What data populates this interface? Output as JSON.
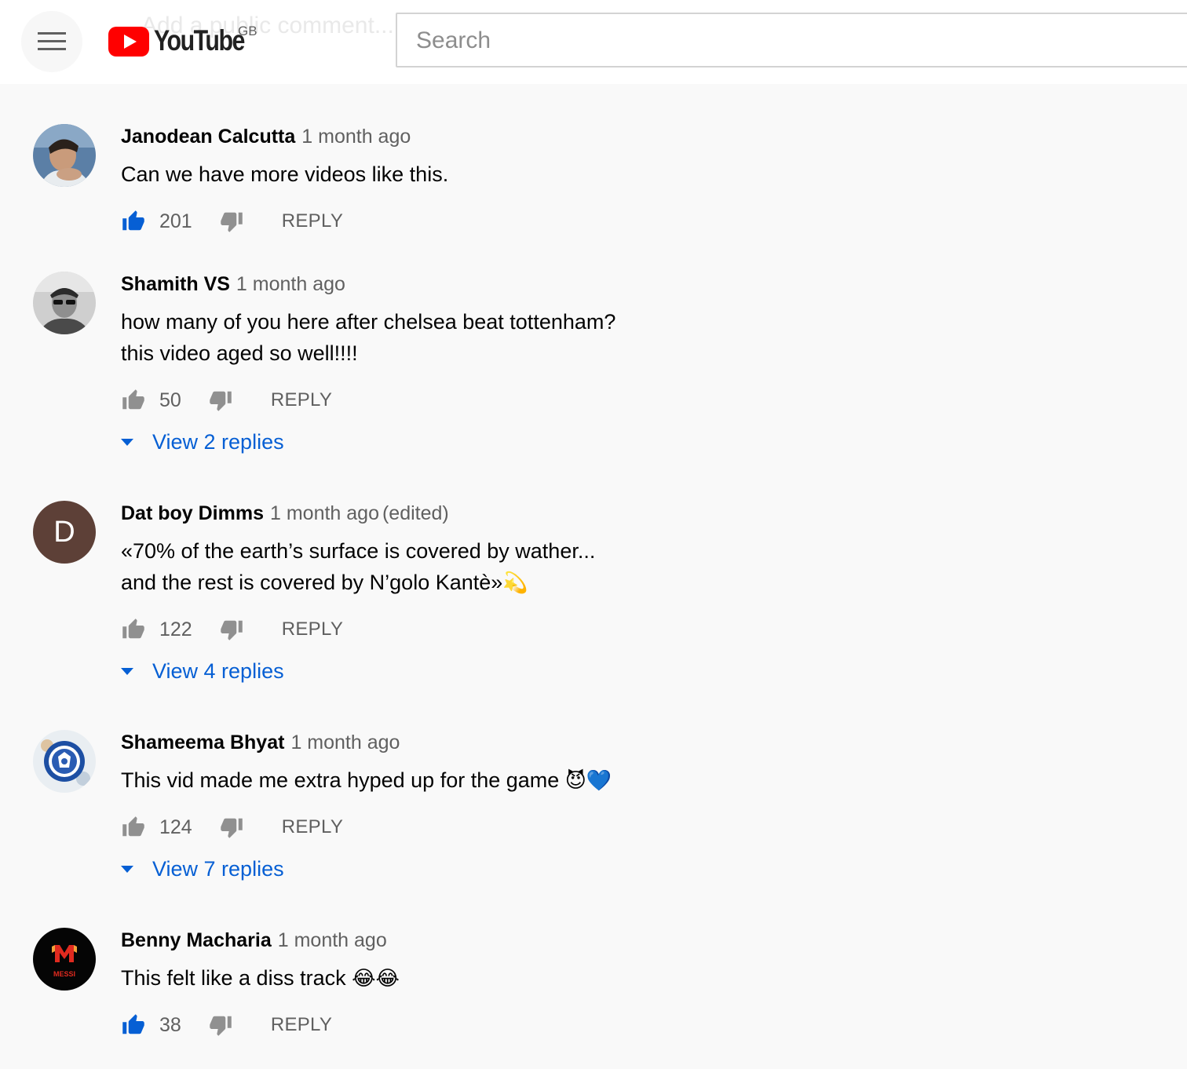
{
  "header": {
    "background_text": "Add a public comment...",
    "logo_text": "YouTube",
    "region": "GB",
    "search_placeholder": "Search"
  },
  "colors": {
    "accent_blue": "#065fd4",
    "like_active": "#065fd4",
    "icon_gray": "#909090",
    "logo_red": "#ff0000"
  },
  "comments": [
    {
      "author": "Janodean Calcutta",
      "time": "1 month ago",
      "edited": "",
      "line1": "Can we have more videos like this.",
      "line2": "",
      "likes": "201",
      "liked": true,
      "reply_label": "REPLY",
      "view_replies": ""
    },
    {
      "author": "Shamith VS",
      "time": "1 month ago",
      "edited": "",
      "line1": "how many of you here after chelsea beat tottenham?",
      "line2": "this video aged so well!!!!",
      "likes": "50",
      "liked": false,
      "reply_label": "REPLY",
      "view_replies": "View 2 replies"
    },
    {
      "author": "Dat boy Dimms",
      "time": "1 month ago",
      "edited": "(edited)",
      "line1": "«70% of the earth’s surface is covered by wather...",
      "line2": "and the rest is covered by N’golo Kantè»",
      "line2_emoji": "💫",
      "avatar_letter": "D",
      "likes": "122",
      "liked": false,
      "reply_label": "REPLY",
      "view_replies": "View 4 replies"
    },
    {
      "author": "Shameema Bhyat",
      "time": "1 month ago",
      "edited": "",
      "line1": "This vid made me extra hyped up for the game ",
      "line1_emoji": "😈💙",
      "line2": "",
      "likes": "124",
      "liked": false,
      "reply_label": "REPLY",
      "view_replies": "View 7 replies"
    },
    {
      "author": "Benny Macharia",
      "time": "1 month ago",
      "edited": "",
      "line1": "This felt like a diss track ",
      "line1_emoji": "😂😂",
      "line2": "",
      "avatar_text": "MESSI",
      "likes": "38",
      "liked": true,
      "reply_label": "REPLY",
      "view_replies": ""
    }
  ]
}
